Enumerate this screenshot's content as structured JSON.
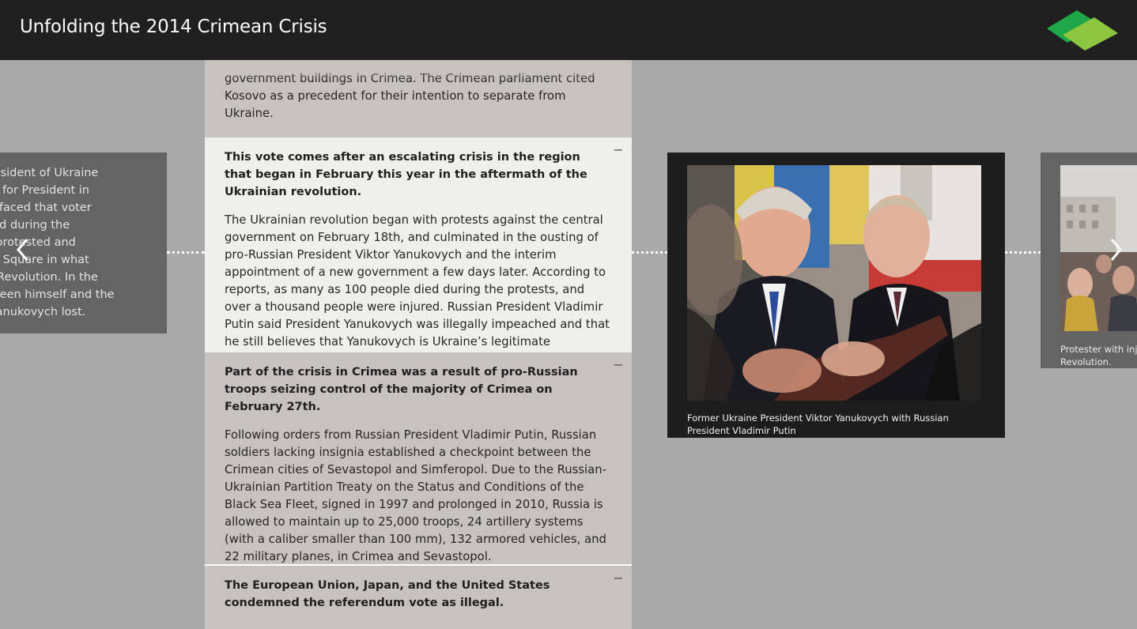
{
  "header": {
    "title": "Unfolding the 2014 Crimean Crisis"
  },
  "prev_card": {
    "text": "e President of Ukraine\nt ran for President in\ns surfaced that voter\nturred during the\nens protested and\nence Square in what\nnge Revolution. In the\nbetween himself and the\nte, Yanukovych lost."
  },
  "sections": {
    "s0": {
      "body": "government buildings in Crimea. The Crimean parliament cited Kosovo as a precedent for their intention to separate from Ukraine."
    },
    "s1": {
      "title": "This vote comes after an escalating crisis in the region that began in February this year in the aftermath of the Ukrainian revolution.",
      "body": "The Ukrainian revolution began with protests against the central government on February 18th, and culminated in the ousting of pro-Russian President Viktor Yanukovych and the interim appointment of a new government a few days later. According to reports, as many as 100 people died during the protests, and over a thousand people were injured. Russian President Vladimir Putin said President Yanukovych was illegally impeached and that he still believes that Yanukovych is Ukraine’s legitimate president."
    },
    "s2": {
      "title": "Part of the crisis in Crimea was a result of pro-Russian troops seizing control of the majority of Crimea on February 27th.",
      "body": "Following orders from Russian President Vladimir Putin, Russian soldiers lacking insignia established a checkpoint between the Crimean cities of Sevastopol and Simferopol. Due to the Russian-Ukrainian Partition Treaty on the Status and Conditions of the Black Sea Fleet, signed in 1997 and prolonged in 2010, Russia is allowed to maintain up to 25,000 troops, 24 artillery systems (with a caliber smaller than 100 mm), 132 armored vehicles, and 22 military planes, in Crimea and Sevastopol."
    },
    "s3": {
      "title": "The European Union, Japan, and the United States condemned the referendum vote as illegal."
    },
    "collapse_symbol": "−"
  },
  "media": {
    "caption": "Former Ukraine President Viktor Yanukovych with Russian President Vladimir Putin"
  },
  "next_card": {
    "caption": "Protester with inju\nRevolution."
  },
  "icons": {
    "prev": "chevron-left-icon",
    "next": "chevron-right-icon",
    "collapse": "minus-icon",
    "logo": "logo-icon"
  },
  "colors": {
    "header_bg": "#202020",
    "page_bg": "#a9a9a9",
    "active_section_bg": "#efefed",
    "inactive_section_bg": "#c6c2bf",
    "logo_dark_green": "#1fa649",
    "logo_light_green": "#8cc63f"
  }
}
